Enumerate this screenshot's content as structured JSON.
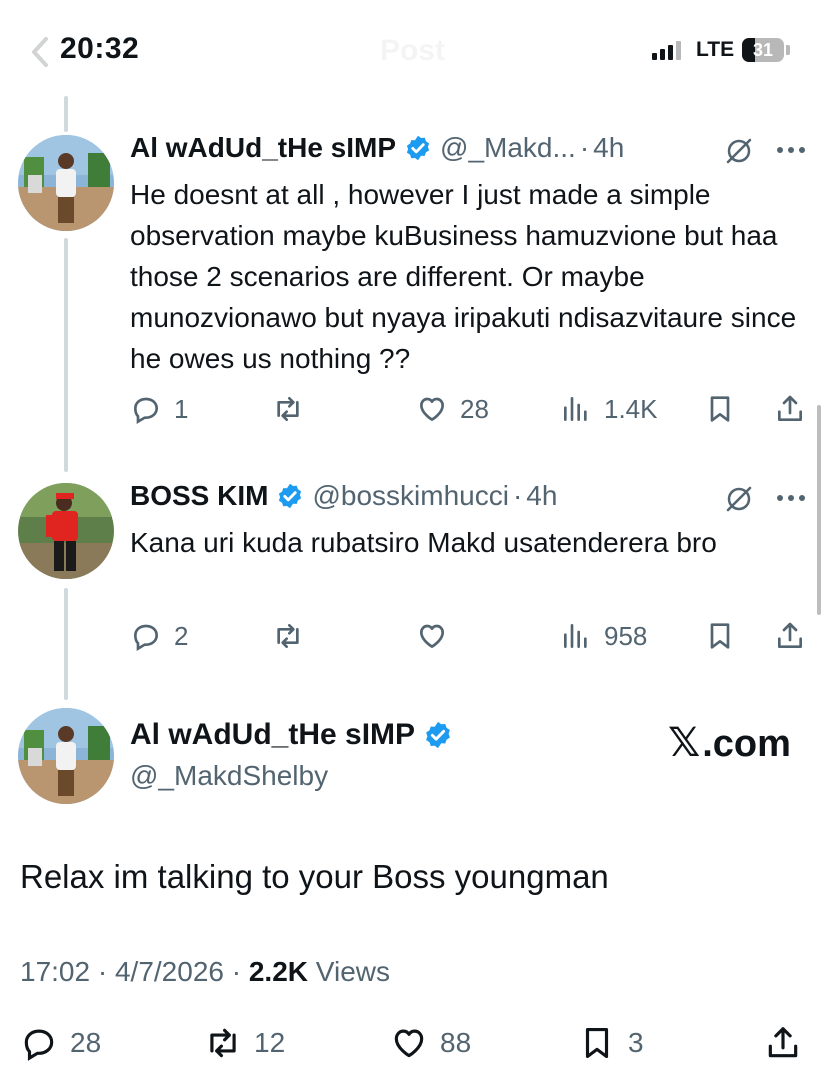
{
  "status_bar": {
    "time": "20:32",
    "network": "LTE",
    "battery_level": "31",
    "nav_title": "Post"
  },
  "colors": {
    "verified": "#1d9bf0",
    "secondary_text": "#536471",
    "thread_line": "#cfd9de"
  },
  "replies": [
    {
      "name": "Al wAdUd_tHe sIMP",
      "handle": "@_Makd...",
      "time": "4h",
      "text": "He doesnt at all , however I just made a simple observation maybe kuBusiness hamuzvione but haa those 2 scenarios are different. Or maybe munozvionawo but nyaya iripakuti ndisazvitaure since he owes us nothing ??",
      "stats": {
        "replies": "1",
        "reposts": "",
        "likes": "28",
        "views": "1.4K"
      }
    },
    {
      "name": "BOSS KIM",
      "handle": "@bosskimhucci",
      "time": "4h",
      "text": "Kana uri kuda rubatsiro Makd usatenderera bro",
      "stats": {
        "replies": "2",
        "reposts": "",
        "likes": "",
        "views": "958"
      }
    }
  ],
  "main_tweet": {
    "name": "Al wAdUd_tHe sIMP",
    "handle": "@_MakdShelby",
    "watermark": ".com",
    "text": "Relax im talking to your Boss youngman",
    "time": "17:02",
    "date": "4/7/2026",
    "views_count": "2.2K",
    "views_label": "Views",
    "stats": {
      "replies": "28",
      "reposts": "12",
      "likes": "88",
      "bookmarks": "3"
    }
  },
  "icons": [
    "back-chevron-icon",
    "verified-badge-icon",
    "grok-icon",
    "more-icon",
    "reply-icon",
    "repost-icon",
    "like-icon",
    "views-icon",
    "bookmark-icon",
    "share-icon",
    "x-logo-icon"
  ]
}
